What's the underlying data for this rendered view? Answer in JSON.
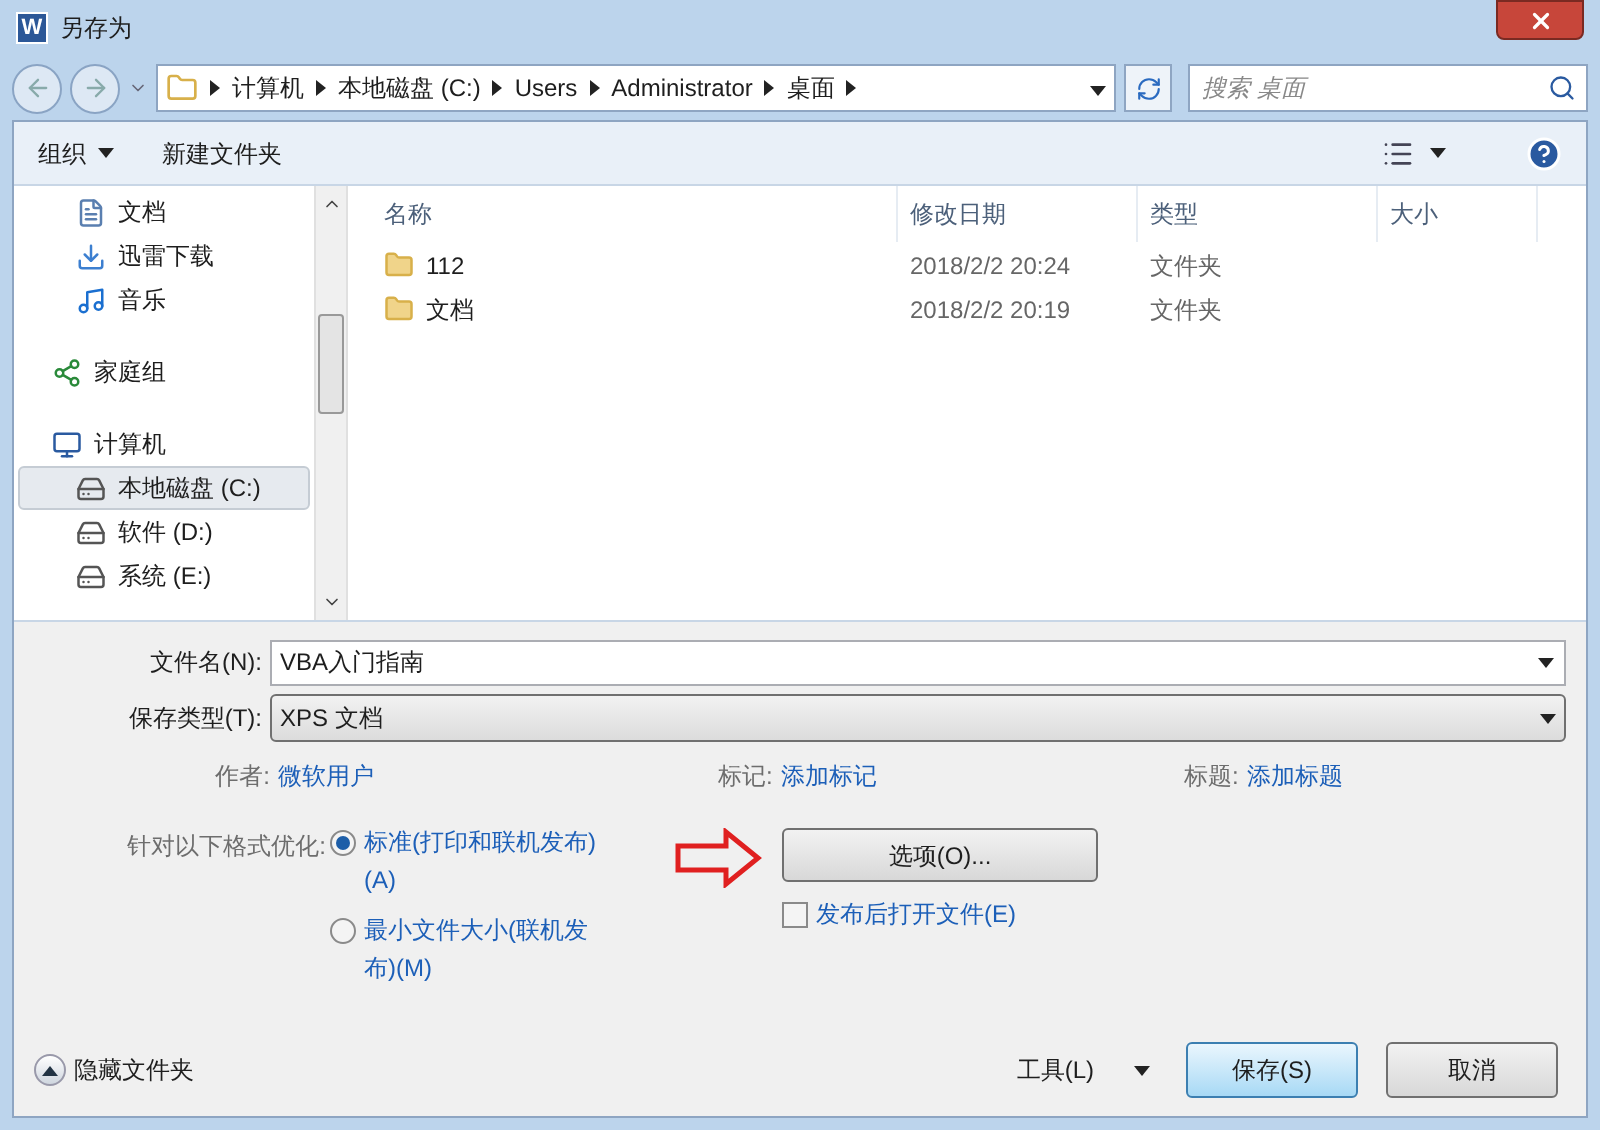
{
  "window": {
    "title": "另存为",
    "app_icon_letter": "W"
  },
  "breadcrumb": [
    "计算机",
    "本地磁盘 (C:)",
    "Users",
    "Administrator",
    "桌面"
  ],
  "search": {
    "placeholder": "搜索 桌面"
  },
  "toolbar": {
    "organize": "组织",
    "new_folder": "新建文件夹"
  },
  "sidebar": {
    "items": [
      {
        "label": "文档",
        "kind": "document",
        "selected": false
      },
      {
        "label": "迅雷下载",
        "kind": "download",
        "selected": false
      },
      {
        "label": "音乐",
        "kind": "music",
        "selected": false
      },
      {
        "label": "家庭组",
        "kind": "homegroup",
        "selected": false
      },
      {
        "label": "计算机",
        "kind": "computer",
        "selected": false
      },
      {
        "label": "本地磁盘 (C:)",
        "kind": "drive",
        "selected": true
      },
      {
        "label": "软件 (D:)",
        "kind": "drive",
        "selected": false
      },
      {
        "label": "系统 (E:)",
        "kind": "drive",
        "selected": false
      }
    ]
  },
  "table": {
    "columns": [
      "名称",
      "修改日期",
      "类型",
      "大小"
    ],
    "rows": [
      [
        "112",
        "2018/2/2 20:24",
        "文件夹"
      ],
      [
        "文档",
        "2018/2/2 20:19",
        "文件夹"
      ]
    ]
  },
  "form": {
    "filename": {
      "label": "文件名(N):",
      "value": "VBA入门指南"
    },
    "filetype": {
      "label": "保存类型(T):",
      "value": "XPS 文档"
    },
    "meta": [
      {
        "label": "作者:",
        "value": "微软用户"
      },
      {
        "label": "标记:",
        "value": "添加标记"
      },
      {
        "label": "标题:",
        "value": "添加标题"
      }
    ],
    "optimize": {
      "label": "针对以下格式优化:",
      "options": [
        {
          "label": "标准(打印和联机发布)(A)",
          "selected": true
        },
        {
          "label": "最小文件大小(联机发布)(M)",
          "selected": false
        }
      ]
    },
    "options_button": "选项(O)...",
    "open_after": {
      "label": "发布后打开文件(E)",
      "checked": false
    }
  },
  "footer": {
    "hide_folders": "隐藏文件夹",
    "tools": "工具(L)",
    "save": "保存(S)",
    "cancel": "取消"
  }
}
